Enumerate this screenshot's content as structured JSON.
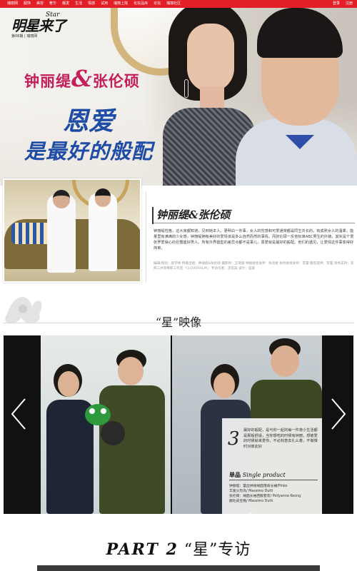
{
  "nav": {
    "items": [
      "瑞丽网",
      "服饰",
      "美容",
      "奢华",
      "靓发",
      "生活",
      "情感",
      "试用",
      "瑞丽上院",
      "化妆品库",
      "论坛",
      "瑞丽社区"
    ],
    "login": "登录",
    "register": "注册"
  },
  "logo": {
    "main": "明星来了",
    "star": "Star",
    "sub": "第08期 | 瑞丽网"
  },
  "hero": {
    "line1_a": "钟丽缇",
    "amp": "&",
    "line1_b": "张伦硕",
    "line2": "恩爱",
    "line3": "是最好的般配"
  },
  "intro": {
    "title": "钟丽缇&张伦硕",
    "body": "钟丽缇性格，这大家都知道，见到她本人，更明白一件事，女人的性感和可爱通常都是同生共长的。有成熟女人的温柔，能量里有满满的少女感，钟丽缇拥有美好的爱情该是多么自然而然的事情。而张伦硕一反他标准ABC男生的外貌，其实是个爱张罗爱操心的巨蟹座好男人。所有外界戳型的差异点都不是事儿，恩爱就是最好的般配。他们的遇见，让爱情这件事变得好简单。",
    "credits": "编辑/策划：梁学林  特邀出镜：钟丽缇&张伦硕  摄影师：王培俊  钟丽缇妆发师：张亮斌  张伦硕妆发师：李蕾  服装提供：李蕾  场地支持：常熟三井草莓影工作室「CLOVERFILM」  专访作者：李蕊菡  设计：蓝斯"
  },
  "gallery": {
    "title": "“星”映像",
    "panel_number": "3",
    "panel_text": "最好的般配，是与你一起的每一件夜小生活都是那般舒适，当你想吃的时候有钟丽，想被爱的时候就来爱你，不必刻意去扎么着，不做慢时对彼此好",
    "single_product_cn": "单品",
    "single_product_en": "Single product",
    "items": [
      "钟丽缇：蕾丝拼接绒面落肩长裙/Pinko",
      "         丰富火烈鸟/ Massimo Dutti",
      "张伦硕：绒面长袖西服套装/ Pollyanna Keong",
      "         翻毛皮豆鞋/ Massimo Dutti"
    ]
  },
  "part2": {
    "prefix": "PART 2",
    "title": "“星”专访"
  },
  "colors": {
    "nav_bg": "#e21f26",
    "hero_pink": "#c41f5a",
    "hero_blue": "#1f4ca6"
  }
}
